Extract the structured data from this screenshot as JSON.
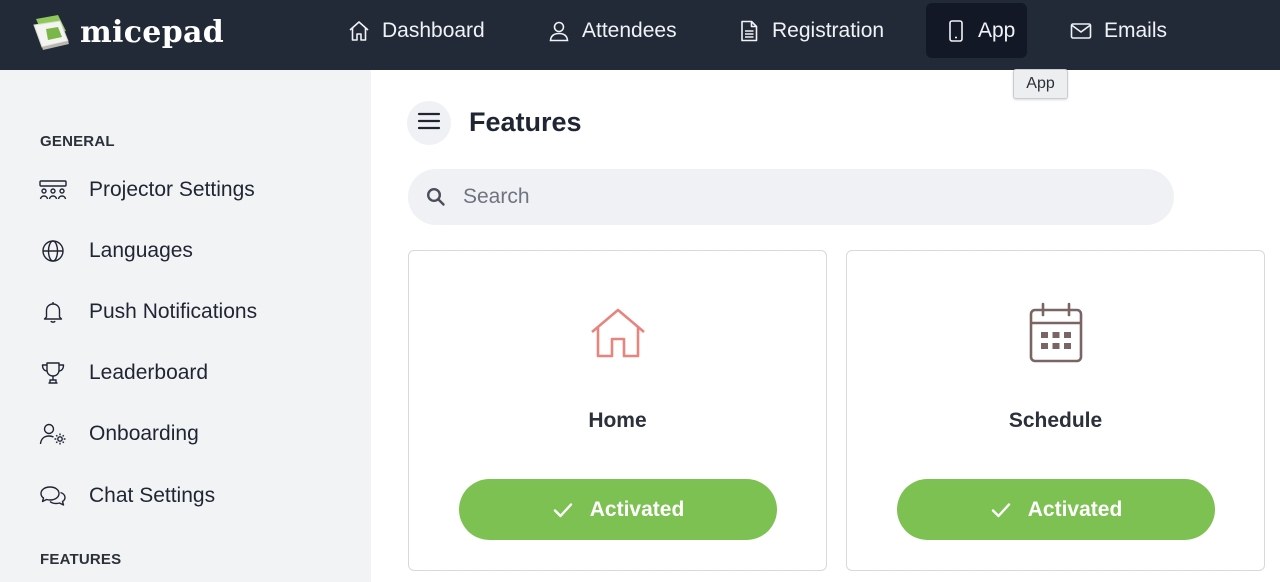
{
  "brand": {
    "name": "micepad"
  },
  "nav": {
    "items": [
      {
        "label": "Dashboard",
        "icon": "home-icon"
      },
      {
        "label": "Attendees",
        "icon": "user-icon"
      },
      {
        "label": "Registration",
        "icon": "document-icon"
      },
      {
        "label": "App",
        "icon": "mobile-phone-icon",
        "active": true
      },
      {
        "label": "Emails",
        "icon": "envelope-icon"
      }
    ],
    "tooltip": "App"
  },
  "sidebar": {
    "sections": [
      {
        "label": "GENERAL",
        "items": [
          {
            "label": "Projector Settings",
            "icon": "audience-icon"
          },
          {
            "label": "Languages",
            "icon": "globe-icon"
          },
          {
            "label": "Push Notifications",
            "icon": "bell-icon"
          },
          {
            "label": "Leaderboard",
            "icon": "trophy-icon"
          },
          {
            "label": "Onboarding",
            "icon": "user-gear-icon"
          },
          {
            "label": "Chat Settings",
            "icon": "chat-bubbles-icon"
          }
        ]
      },
      {
        "label": "FEATURES",
        "items": []
      }
    ]
  },
  "main": {
    "title": "Features",
    "search": {
      "placeholder": "Search",
      "value": ""
    },
    "cards": [
      {
        "title": "Home",
        "icon": "house-icon",
        "icon_color": "#e8847e",
        "status": "Activated"
      },
      {
        "title": "Schedule",
        "icon": "calendar-icon",
        "icon_color": "#7a6464",
        "status": "Activated"
      }
    ]
  },
  "colors": {
    "topbar": "#222a38",
    "active_nav": "#121826",
    "sidebar_bg": "#f2f3f5",
    "activated": "#7cc152"
  }
}
